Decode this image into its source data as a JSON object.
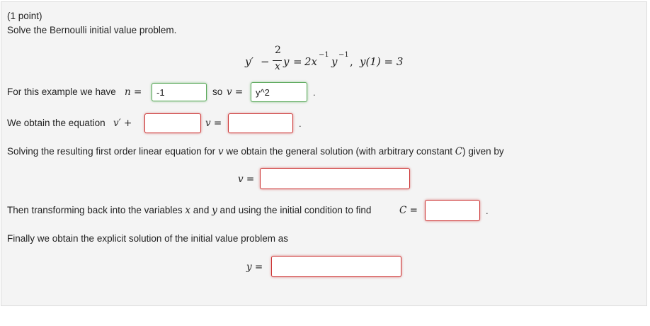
{
  "header": {
    "points": "(1 point)",
    "instruction": "Solve the Bernoulli initial value problem."
  },
  "equation": {
    "lhs_y": "y′",
    "minus": "−",
    "frac_num": "2",
    "frac_den": "x",
    "y_after": "y",
    "equals": "=",
    "rhs_coef": "2x",
    "exp1": "−1",
    "rhs_y": "y",
    "exp2": "−1",
    "comma": ",",
    "ic": "y(1) = 3"
  },
  "row_n": {
    "prefix": "For this example we have",
    "n_label": "n =",
    "n_value": "-1",
    "so_text": "so",
    "v_label": "v =",
    "v_value": "y^2",
    "suffix": "."
  },
  "row_eq": {
    "prefix": "We obtain the equation",
    "vprime": "v′ +",
    "v_eq": "v =",
    "field1_value": "",
    "field2_value": "",
    "suffix": "."
  },
  "row_general": {
    "text_before": "Solving the resulting first order linear equation for",
    "v_var": "v",
    "text_middle": "we obtain the general solution (with arbitrary constant",
    "c_var": "C",
    "text_after": ") given by",
    "v_label": "v =",
    "field_value": ""
  },
  "row_c": {
    "text_before": "Then transforming back into the variables",
    "x_var": "x",
    "and_text": "and",
    "y_var": "y",
    "text_after": "and using the initial condition to find",
    "c_label": "C =",
    "field_value": "",
    "suffix": "."
  },
  "row_final": {
    "text": "Finally we obtain the explicit solution of the initial value problem as",
    "y_label": "y =",
    "field_value": ""
  },
  "colors": {
    "panel_bg": "#f4f4f4",
    "incorrect_border": "#cc3333",
    "correct_border": "#5aa85a"
  }
}
